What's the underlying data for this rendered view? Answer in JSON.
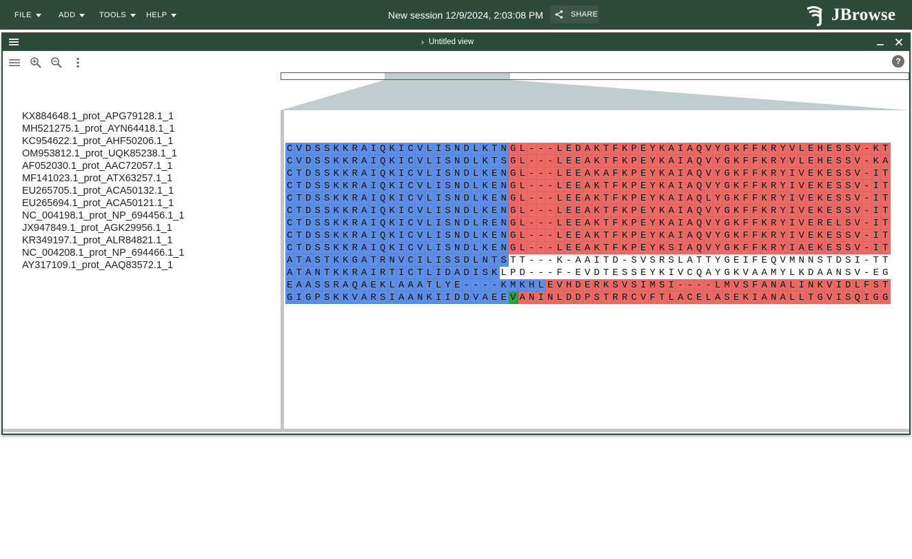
{
  "appbar": {
    "menus": [
      "FILE",
      "ADD",
      "TOOLS",
      "HELP"
    ],
    "session_title": "New session 12/9/2024, 2:03:08 PM",
    "share_label": "SHARE",
    "logo_text": "JBrowse",
    "background": "#2e4a3b"
  },
  "view": {
    "title": "Untitled view",
    "icons": [
      "hamburger-menu-icon",
      "minimize-icon",
      "close-icon"
    ],
    "toolbar_icons": [
      "list-icon",
      "zoom-in-icon",
      "zoom-out-icon",
      "more-vert-icon"
    ],
    "help_label": "?"
  },
  "colors": {
    "blue_region": "#5d8ee8",
    "red_region": "#ec6a65",
    "green_residue": "#2ea043",
    "overview_selection": "#bfcdcf"
  },
  "alignment": {
    "rows": [
      {
        "name": "KX884648.1_prot_APG79128.1_1",
        "seq": "CVDSSKKRAIQKICVLISNDLKTNGL---LEDAKTFKPEYKAIAQVYGKFFKRYVLEHESSV-KT"
      },
      {
        "name": "MH521275.1_prot_AYN64418.1_1",
        "seq": "CVDSSKKRAIQKICVLISNDLKTSGL---LEEAKTFKPEYKAIAQVYGKFFKRYVLEHESSV-KA"
      },
      {
        "name": "KC954622.1_prot_AHF50206.1_1",
        "seq": "CTDSSKKRAIQKICVLISNDLKENGL---LEEAKAFKPEYKAIAQVYGKFFKRYIVEKESSV-IT"
      },
      {
        "name": "OM953812.1_prot_UQK85238.1_1",
        "seq": "CTDSSKKRAIQKICVLISNDLKENGL---LEEAKTFKPEYKAIAQVYGKFFKRYIVEKESSV-IT"
      },
      {
        "name": "AF052030.1_prot_AAC72057.1_1",
        "seq": "CTDSSKKRAIQKICVLISNDLKENGL---LEEAKTFKPEYKAIAQLYGKFFKRYIVEKESSV-IT"
      },
      {
        "name": "MF141023.1_prot_ATX63257.1_1",
        "seq": "CTDSSKKRAIQKICVLISNDLKENGL---LEEAKTFKPEYKAIAQVYGKFFKRYIVEKESSV-IT"
      },
      {
        "name": "EU265705.1_prot_ACA50132.1_1",
        "seq": "CTDSSKKRAIQKICVLISNDLRENGL---LEEAKTFKPEYKAIAQVYGKFFKRYIVERELSV-IT"
      },
      {
        "name": "EU265694.1_prot_ACA50121.1_1",
        "seq": "CTDSSKKRAIQKICVLISNDLKENGL---LEEAKTFKPEYKAIAQVYGKFFKRYIVEKESSV-IT"
      },
      {
        "name": "NC_004198.1_prot_NP_694456.1_1",
        "seq": "CTDSSKKRAIQKICVLISNDLKENGL---LEEAKTFKPEYKSIAQVYGKFFKRYIAEKESSV-IT"
      },
      {
        "name": "JX947849.1_prot_AGK29956.1_1",
        "seq": "ATASTKKGATRNVCILISSDLNTSTT---K-AAITD-SVSRSLATTYGEIFEQVMNNSTDSI-TT"
      },
      {
        "name": "KR349197.1_prot_ALR84821.1_1",
        "seq": "ATANTKKRAIRTICTLIDADISKLPD---F-EVDTESSEYKIVCQAYGKVAAMYLKDAANSV-EG"
      },
      {
        "name": "NC_004208.1_prot_NP_694466.1_1",
        "seq": "EAASSRAQAEKLAAATLYE----KMKHLEVHDERKSVSIMSI----LMVSFANALINKVIDLFST"
      },
      {
        "name": "AY317109.1_prot_AAQ83572.1_1",
        "seq": "GIGPSKKVARSIAANKIIDDVAEEVANINLDDPSTRRCVFTLACELASEKIANALLTGVISQIGG"
      }
    ],
    "blue_span": [
      24,
      24,
      24,
      24,
      24,
      24,
      24,
      24,
      24,
      24,
      23,
      28,
      24
    ],
    "red_start": [
      24,
      24,
      24,
      24,
      24,
      24,
      24,
      24,
      24,
      -1,
      -1,
      28,
      25
    ],
    "green_cells": [
      {
        "row": 12,
        "col": 24
      }
    ]
  }
}
